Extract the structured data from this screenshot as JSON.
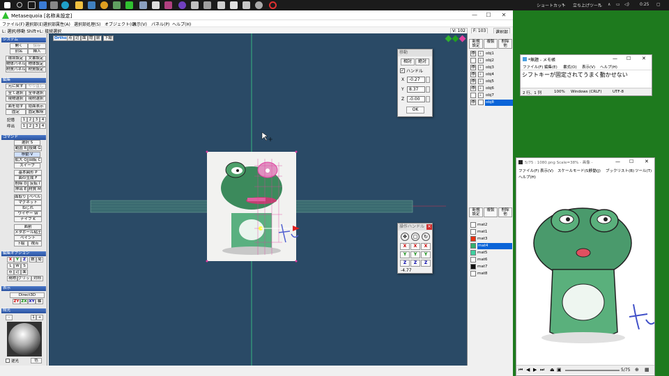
{
  "taskbar": {
    "shortcut_label": "ショートカット",
    "launcher_label": "立ち上げツール",
    "clock": "0:25",
    "chevron": "»"
  },
  "main_window": {
    "title": "Metasequoia [名称未設定]",
    "menu": [
      "ファイル(F)",
      "選択部(E)",
      "選択部属性(A)",
      "選択部処理(S)",
      "オブジェクト(O)",
      "表示(V)",
      "パネル(P)",
      "ヘルプ(H)"
    ],
    "status_left": "L: 選択/移動 Shift+L: 接続選択",
    "vertex_count": "V: 102",
    "face_count": "F: 103",
    "status_right": "選択部",
    "min_btn": "—",
    "max_btn": "☐",
    "close_btn": "✕"
  },
  "left_panel": {
    "system": {
      "head": "システム",
      "btns": [
        "開く",
        "保存",
        "別名",
        "挿入",
        "環境設定",
        "文書設定",
        "物体パネル",
        "物体設定",
        "材質パネル",
        "材質設定"
      ]
    },
    "edit": {
      "head": "編集",
      "btns": [
        "元に戻す",
        "やり直し",
        "全て選択",
        "全非選択",
        "現物選択",
        "現材選択",
        "面を隠す",
        "隠面表示",
        "固定",
        "固定解除"
      ]
    },
    "memory": {
      "store_label": "記憶",
      "recall_label": "呼出",
      "slots": [
        "1",
        "2",
        "3",
        "4"
      ]
    },
    "commands": {
      "head": "コマンド",
      "btns": [
        "選択 S",
        "範囲 R",
        "投縄 G",
        "移動 V",
        "拡大 Q",
        "回転 C",
        "スイープ",
        "基本図形 P",
        "面の生成 F",
        "削除 D",
        "反転 I",
        "押出 E",
        "材質 M",
        "面取り H",
        "ベベル",
        "マグネット",
        "ねじれ",
        "ワイヤー W",
        "ナイフ K",
        "面割",
        "メタボール粘土",
        "ペイント",
        "下絵",
        "視点"
      ]
    },
    "edit_option": {
      "head": "編集オプション",
      "axis_btns": [
        "X",
        "Y",
        "Z",
        "数",
        "局"
      ],
      "mode_btns": [
        "L",
        "W",
        "S"
      ],
      "sel_btns": [
        "点",
        "辺",
        "面"
      ],
      "target_btns": [
        "現物",
        "グリッド",
        "対称"
      ]
    },
    "display": {
      "head": "表示",
      "renderer": "Direct3D",
      "plane_btns": [
        "ZY",
        "ZX",
        "XY",
        "軸"
      ]
    },
    "lighting": {
      "head": "照光",
      "minus": "-",
      "plus": "+",
      "value": "1",
      "backlight_label": "逆光",
      "color_btn": "色"
    }
  },
  "viewport": {
    "tools": [
      "Ortho",
      "点",
      "辺",
      "面",
      "隠",
      "前",
      "下絵"
    ]
  },
  "move_dialog": {
    "title": "移動",
    "relative": "相対",
    "absolute": "絶対",
    "handle_label": "ハンドル",
    "x_label": "X",
    "x_value": "-0.27",
    "y_label": "Y",
    "y_value": "8.37",
    "z_label": "Z",
    "z_value": "-0.00",
    "ok": "OK"
  },
  "handle_dialog": {
    "title": "操作ハンドル",
    "value": "-4.77",
    "axes": [
      "X",
      "Y",
      "Z"
    ]
  },
  "object_panel": {
    "buttons": [
      "新規",
      "複製",
      "削除",
      "設定",
      "",
      "他"
    ],
    "objects": [
      "obj1",
      "obj2",
      "obj3",
      "obj4",
      "obj5",
      "obj6",
      "obj7",
      "obj8"
    ],
    "selected_object": "obj8",
    "mat_buttons": [
      "新規",
      "複製",
      "削除",
      "設定",
      "",
      "他"
    ],
    "materials": [
      {
        "name": "mat2",
        "color": "#ffffff"
      },
      {
        "name": "mat1",
        "color": "#ffffff"
      },
      {
        "name": "mat3",
        "color": "#e83010"
      },
      {
        "name": "mat4",
        "color": "#30b070"
      },
      {
        "name": "mat5",
        "color": "#40d0a0"
      },
      {
        "name": "mat6",
        "color": "#ffffff"
      },
      {
        "name": "mat7",
        "color": "#101010"
      },
      {
        "name": "mat8",
        "color": "#ffffff"
      }
    ],
    "selected_material": "mat4"
  },
  "notepad": {
    "title": "*無題 - メモ帳",
    "menu": [
      "ファイル(F)",
      "編集(E)",
      "書式(O)",
      "表示(V)",
      "ヘルプ(H)"
    ],
    "content": "シフトキーが固定されてうまく動かせない",
    "position": "2 行、1 列",
    "zoom": "100%",
    "eol": "Windows (CRLF)",
    "encoding": "UTF-8"
  },
  "viewer": {
    "title": "5/75 : 1080.png  Scale=38%  - 画像 -",
    "menu": [
      "ファイル(F)",
      "表示(V)",
      "スケールモード(S)",
      "移動(J)",
      "ブックリスト(B)",
      "ツール(T)",
      "ヘルプ(H)"
    ],
    "page": "5/75"
  },
  "colors": {
    "accent": "#0a64d8",
    "viewport_bg": "#2a4a66",
    "desktop_bg": "#1e7a1e",
    "selection": "#e0409a"
  }
}
